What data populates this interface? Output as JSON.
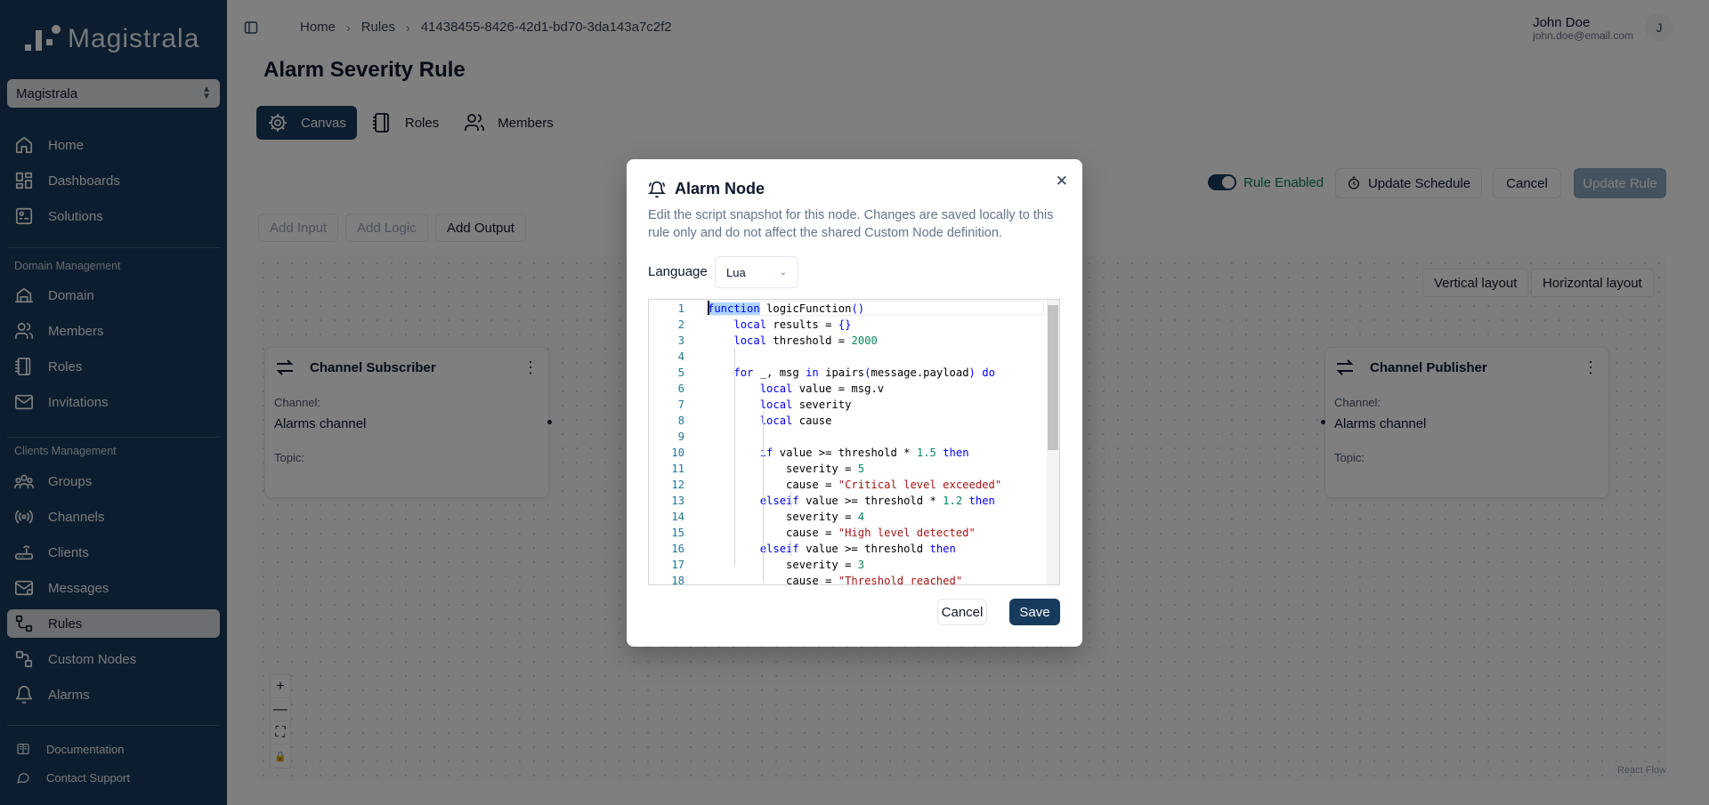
{
  "app": {
    "name": "Magistrala"
  },
  "sidebar": {
    "domain_select": "Magistrala",
    "top_items": [
      {
        "label": "Home",
        "icon": "home-icon"
      },
      {
        "label": "Dashboards",
        "icon": "dashboard-icon"
      },
      {
        "label": "Solutions",
        "icon": "solutions-icon"
      }
    ],
    "domain_section": "Domain Management",
    "domain_items": [
      {
        "label": "Domain",
        "icon": "domain-icon"
      },
      {
        "label": "Members",
        "icon": "members-icon"
      },
      {
        "label": "Roles",
        "icon": "roles-icon"
      },
      {
        "label": "Invitations",
        "icon": "mail-icon"
      }
    ],
    "clients_section": "Clients Management",
    "clients_items": [
      {
        "label": "Groups",
        "icon": "groups-icon"
      },
      {
        "label": "Channels",
        "icon": "channels-icon"
      },
      {
        "label": "Clients",
        "icon": "clients-icon"
      },
      {
        "label": "Messages",
        "icon": "messages-icon"
      },
      {
        "label": "Rules",
        "icon": "rules-icon",
        "active": true
      },
      {
        "label": "Custom Nodes",
        "icon": "custom-nodes-icon"
      },
      {
        "label": "Alarms",
        "icon": "bell-icon"
      }
    ],
    "footer_items": [
      {
        "label": "Documentation",
        "icon": "book-icon"
      },
      {
        "label": "Contact Support",
        "icon": "chat-icon"
      }
    ]
  },
  "header": {
    "breadcrumb": [
      "Home",
      "Rules",
      "41438455-8426-42d1-bd70-3da143a7c2f2"
    ],
    "user_name": "John Doe",
    "user_email": "john.doe@email.com",
    "avatar_initial": "J"
  },
  "page": {
    "title": "Alarm Severity Rule",
    "tabs": [
      {
        "label": "Canvas",
        "active": true
      },
      {
        "label": "Roles"
      },
      {
        "label": "Members"
      }
    ],
    "rule_enabled_label": "Rule Enabled",
    "update_schedule": "Update Schedule",
    "cancel": "Cancel",
    "update_rule": "Update Rule",
    "add_input": "Add Input",
    "add_logic": "Add Logic",
    "add_output": "Add Output"
  },
  "canvas": {
    "vertical_layout": "Vertical layout",
    "horizontal_layout": "Horizontal layout",
    "attribution": "React Flow",
    "controls": [
      "+",
      "—",
      "⛶",
      "🔒"
    ],
    "nodes": [
      {
        "title": "Channel Subscriber",
        "channel_label": "Channel:",
        "channel": "Alarms channel",
        "topic_label": "Topic:"
      },
      {
        "title": "Channel Publisher",
        "channel_label": "Channel:",
        "channel": "Alarms channel",
        "topic_label": "Topic:"
      }
    ]
  },
  "modal": {
    "title": "Alarm Node",
    "description": "Edit the script snapshot for this node. Changes are saved locally to this rule only and do not affect the shared Custom Node definition.",
    "language_label": "Language",
    "language": "Lua",
    "cancel": "Cancel",
    "save": "Save",
    "code_lines": [
      "function logicFunction()",
      "    local results = {}",
      "    local threshold = 2000",
      "",
      "    for _, msg in ipairs(message.payload) do",
      "        local value = msg.v",
      "        local severity",
      "        local cause",
      "",
      "        if value >= threshold * 1.5 then",
      "            severity = 5",
      "            cause = \"Critical level exceeded\"",
      "        elseif value >= threshold * 1.2 then",
      "            severity = 4",
      "            cause = \"High level detected\"",
      "        elseif value >= threshold then",
      "            severity = 3",
      "            cause = \"Threshold reached\""
    ]
  }
}
